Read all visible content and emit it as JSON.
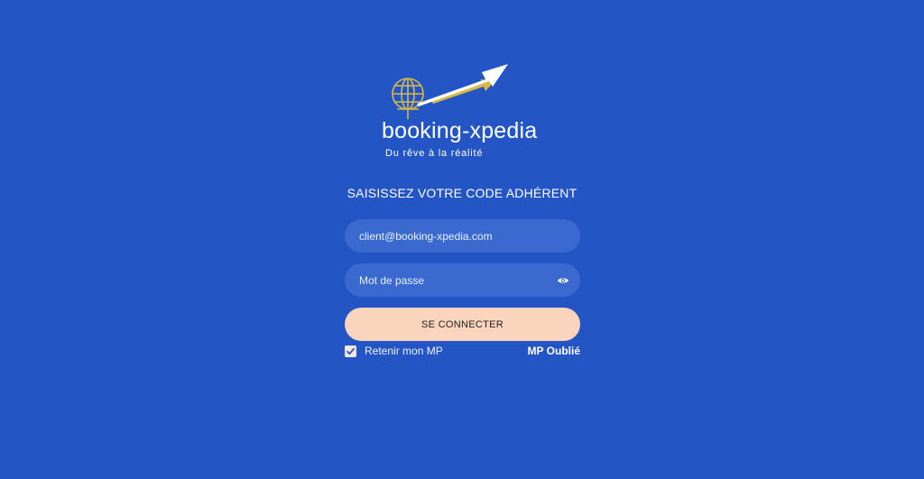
{
  "logo": {
    "brand_name": "booking-xpedia",
    "tagline": "Du rêve à la réalité",
    "icon": "globe-arrow-logo-icon"
  },
  "heading": "SAISISSEZ VOTRE CODE ADHÉRENT",
  "form": {
    "email_placeholder": "client@booking-xpedia.com",
    "password_placeholder": "Mot de passe",
    "show_password_icon": "eye-icon",
    "submit_label": "SE CONNECTER",
    "remember_label": "Retenir mon MP",
    "remember_checked": true,
    "forgot_label": "MP Oublié"
  },
  "colors": {
    "background": "#2356c4",
    "field": "#3a69cf",
    "button": "#fad4bd",
    "logo_gold": "#d9b84a"
  }
}
